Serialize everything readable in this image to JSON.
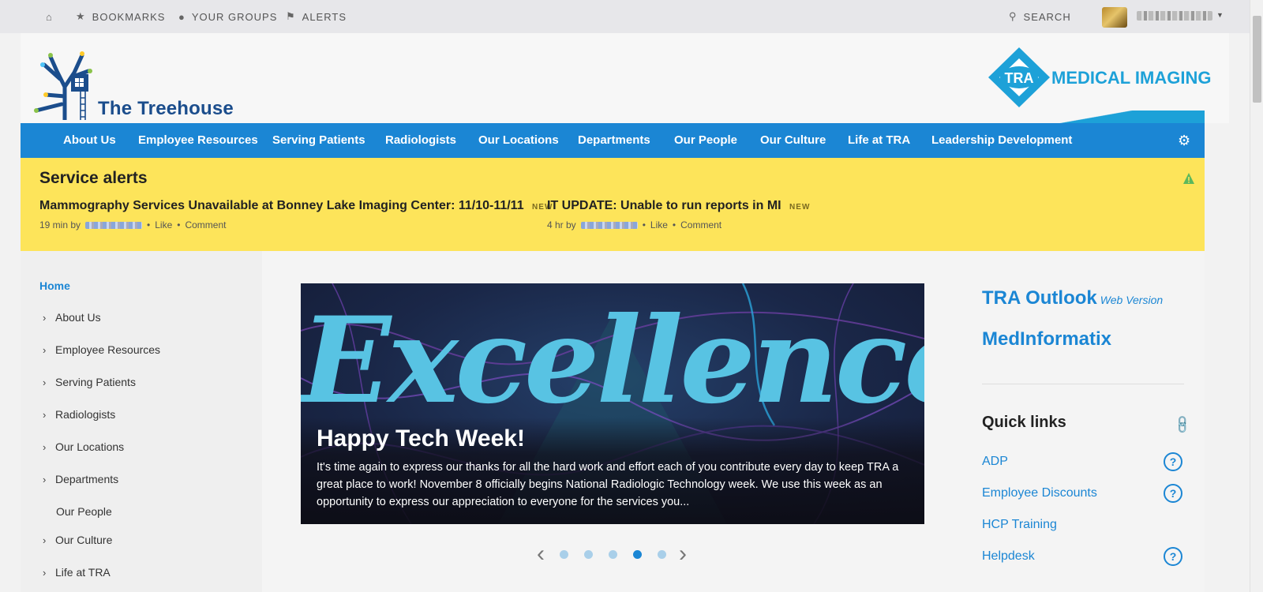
{
  "topbar": {
    "home_icon": "home-icon",
    "bookmarks": "BOOKMARKS",
    "your_groups": "YOUR GROUPS",
    "alerts": "ALERTS",
    "search": "SEARCH"
  },
  "header": {
    "site_name": "The Treehouse",
    "partner": "MEDICAL IMAGING",
    "partner_mark": "TRA"
  },
  "nav": {
    "items": [
      "About Us",
      "Employee Resources",
      "Serving Patients",
      "Radiologists",
      "Our Locations",
      "Departments",
      "Our People",
      "Our Culture",
      "Life at TRA",
      "Leadership Development"
    ]
  },
  "alerts": {
    "title": "Service alerts",
    "items": [
      {
        "headline": "Mammography Services Unavailable at Bonney Lake Imaging Center: 11/10-11/11",
        "badge": "NEW",
        "time": "19 min by",
        "like": "Like",
        "comment": "Comment"
      },
      {
        "headline": "IT UPDATE: Unable to run reports in MI",
        "badge": "NEW",
        "time": "4 hr by",
        "like": "Like",
        "comment": "Comment"
      }
    ]
  },
  "leftnav": {
    "home": "Home",
    "items": [
      "About Us",
      "Employee Resources",
      "Serving Patients",
      "Radiologists",
      "Our Locations",
      "Departments",
      "Our People",
      "Our Culture",
      "Life at TRA"
    ]
  },
  "hero": {
    "word": "Excellence",
    "title": "Happy Tech Week!",
    "body": "It's time again to express our thanks for all the hard work and effort each of you contribute every day to keep TRA a great place to work! November 8 officially begins National Radiologic Technology week. We use this week as an opportunity to express our appreciation to everyone for the services you...",
    "slides": 5,
    "active_slide": 4
  },
  "right": {
    "outlook": "TRA Outlook",
    "outlook_sub": "Web Version",
    "medinformatix": "MedInformatix",
    "quick_links_title": "Quick links",
    "quick_links": [
      "ADP",
      "Employee Discounts",
      "HCP Training",
      "Helpdesk"
    ]
  },
  "colors": {
    "brand_blue": "#1b86d4",
    "alert_yellow": "#fde45a",
    "tra_cyan": "#1da1d8"
  }
}
